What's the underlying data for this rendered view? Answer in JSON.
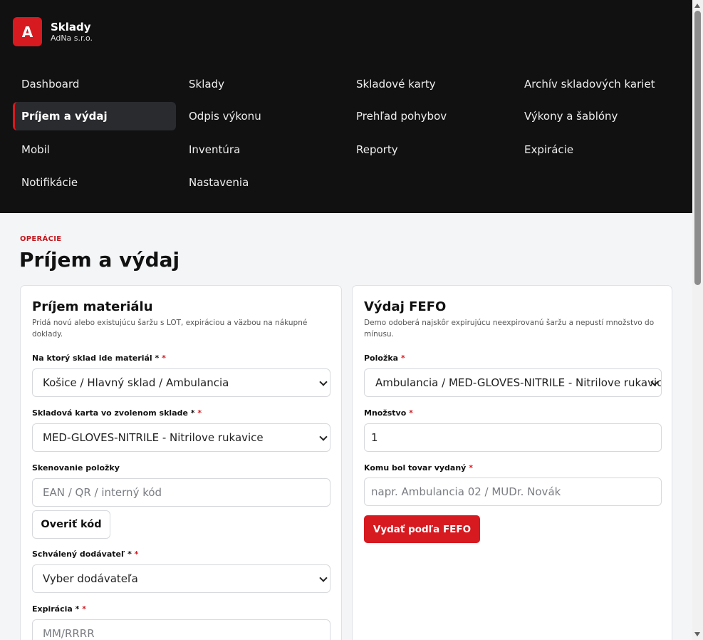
{
  "brand": {
    "logo_letter": "A",
    "title": "Sklady",
    "subtitle": "AdNa s.r.o.",
    "accent_color": "#d71920"
  },
  "nav": {
    "items": [
      {
        "label": "Dashboard",
        "active": false
      },
      {
        "label": "Sklady",
        "active": false
      },
      {
        "label": "Skladové karty",
        "active": false
      },
      {
        "label": "Archív skladových kariet",
        "active": false
      },
      {
        "label": "Príjem a výdaj",
        "active": true
      },
      {
        "label": "Odpis výkonu",
        "active": false
      },
      {
        "label": "Prehľad pohybov",
        "active": false
      },
      {
        "label": "Výkony a šablóny",
        "active": false
      },
      {
        "label": "Mobil",
        "active": false
      },
      {
        "label": "Inventúra",
        "active": false
      },
      {
        "label": "Reporty",
        "active": false
      },
      {
        "label": "Expirácie",
        "active": false
      },
      {
        "label": "Notifikácie",
        "active": false
      },
      {
        "label": "Nastavenia",
        "active": false
      }
    ]
  },
  "page": {
    "eyebrow": "OPERÁCIE",
    "title": "Príjem a výdaj"
  },
  "receipt": {
    "title": "Príjem materiálu",
    "description": "Pridá novú alebo existujúcu šaržu s LOT, expiráciou a väzbou na nákupné doklady.",
    "warehouse_label": "Na ktorý sklad ide materiál *",
    "warehouse_value": "Košice / Hlavný sklad / Ambulancia",
    "card_label": "Skladová karta vo zvolenom sklade *",
    "card_value": "MED-GLOVES-NITRILE - Nitrilove rukavice",
    "scan_label": "Skenovanie položky",
    "scan_placeholder": "EAN / QR / interný kód",
    "verify_button": "Overiť kód",
    "supplier_label": "Schválený dodávateľ *",
    "supplier_value": "Vyber dodávateľa",
    "expiry_label": "Expirácia *",
    "expiry_placeholder": "MM/RRRR"
  },
  "issue": {
    "title": "Výdaj FEFO",
    "description": "Demo odoberá najskôr expirujúcu neexpirovanú šaržu a nepustí množstvo do mínusu.",
    "item_label": "Položka",
    "item_value": "Ambulancia / MED-GLOVES-NITRILE - Nitrilove rukavice",
    "qty_label": "Množstvo",
    "qty_value": "1",
    "recipient_label": "Komu bol tovar vydaný",
    "recipient_placeholder": "napr. Ambulancia 02 / MUDr. Novák",
    "issue_button": "Vydať podľa FEFO"
  },
  "required_marker": "*"
}
